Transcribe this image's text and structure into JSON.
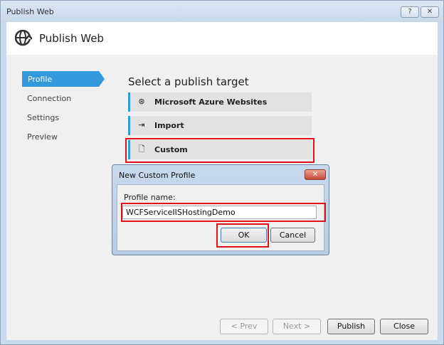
{
  "window": {
    "title": "Publish Web",
    "help_label": "?",
    "close_label": "✕"
  },
  "header": {
    "title": "Publish Web",
    "icon": "globe-publish-icon"
  },
  "sidebar": {
    "items": [
      {
        "label": "Profile",
        "selected": true
      },
      {
        "label": "Connection"
      },
      {
        "label": "Settings"
      },
      {
        "label": "Preview"
      }
    ]
  },
  "main": {
    "heading": "Select a publish target",
    "targets": [
      {
        "label": "Microsoft Azure Websites",
        "icon": "azure-icon",
        "glyph": "⊛"
      },
      {
        "label": "Import",
        "icon": "import-icon",
        "glyph": "⇥"
      },
      {
        "label": "Custom",
        "icon": "document-icon",
        "glyph": "🗋"
      }
    ]
  },
  "dialog": {
    "title": "New Custom Profile",
    "close_label": "✕",
    "profile_label": "Profile name:",
    "profile_value": "WCFServiceIISHostingDemo",
    "ok": "OK",
    "cancel": "Cancel"
  },
  "footer": {
    "prev": "< Prev",
    "next": "Next >",
    "publish": "Publish",
    "close": "Close"
  },
  "colors": {
    "accent": "#3399dd",
    "highlight": "#e0121a"
  }
}
